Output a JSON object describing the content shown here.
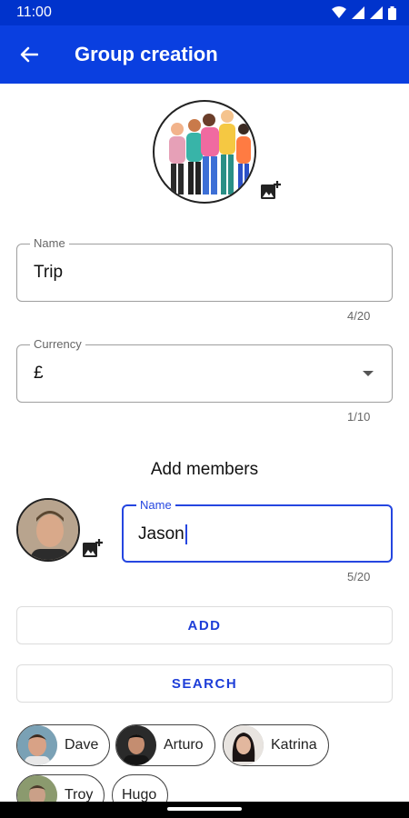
{
  "status_bar": {
    "time": "11:00",
    "icons": [
      "wifi-icon",
      "signal-icon",
      "signal-icon",
      "battery-icon"
    ]
  },
  "app_bar": {
    "title": "Group creation",
    "back_icon": "arrow-left-icon"
  },
  "group_photo": {
    "icon": "group-people-illustration",
    "add_photo_icon": "add-photo-icon"
  },
  "name_field": {
    "label": "Name",
    "value": "Trip",
    "counter": "4/20"
  },
  "currency_field": {
    "label": "Currency",
    "value": "£",
    "counter": "1/10"
  },
  "add_members": {
    "title": "Add members",
    "member_name_field": {
      "label": "Name",
      "value": "Jason",
      "counter": "5/20"
    },
    "add_label": "ADD",
    "search_label": "SEARCH"
  },
  "members": [
    {
      "name": "Dave"
    },
    {
      "name": "Arturo"
    },
    {
      "name": "Katrina"
    },
    {
      "name": "Troy"
    },
    {
      "name": "Hugo"
    }
  ],
  "colors": {
    "primary": "#0a3fe0",
    "status_bar": "#0033cc",
    "accent": "#1e3ed8"
  }
}
